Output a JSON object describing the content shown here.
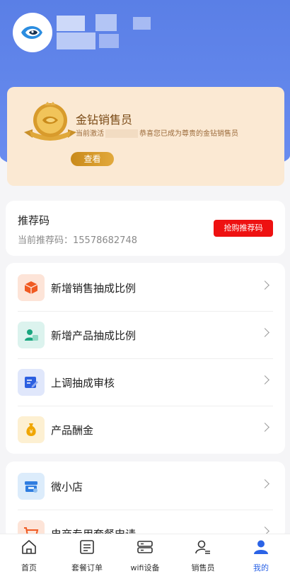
{
  "header": {
    "avatar_icon": "fish-logo-icon"
  },
  "member": {
    "title": "金钻销售员",
    "desc_prefix": "当前激活",
    "desc_suffix": "恭喜您已成为尊贵的金钻销售员",
    "view_button": "查看"
  },
  "referral": {
    "title": "推荐码",
    "label": "当前推荐码：",
    "code": "15578682748",
    "buy_button": "抢购推荐码"
  },
  "menu": [
    {
      "label": "新增销售抽成比例",
      "icon": "cube-icon",
      "bg": "#fde4d8",
      "color": "#f05a22"
    },
    {
      "label": "新增产品抽成比例",
      "icon": "user-card-icon",
      "bg": "#dcf3ee",
      "color": "#1aa67f"
    },
    {
      "label": "上调抽成审核",
      "icon": "edit-document-icon",
      "bg": "#e0e7fb",
      "color": "#2c5fe0"
    },
    {
      "label": "产品酬金",
      "icon": "money-bag-icon",
      "bg": "#fdf0d2",
      "color": "#f0a600"
    }
  ],
  "menu2": [
    {
      "label": "微小店",
      "icon": "shop-icon",
      "bg": "#dcecfb",
      "color": "#2f7de0"
    },
    {
      "label": "电商专用套餐申请",
      "icon": "cart-icon",
      "bg": "#fde4d8",
      "color": "#f05a22"
    }
  ],
  "tabs": [
    {
      "label": "首页",
      "icon": "home-icon"
    },
    {
      "label": "套餐订单",
      "icon": "order-list-icon"
    },
    {
      "label": "wifi设备",
      "icon": "router-icon"
    },
    {
      "label": "销售员",
      "icon": "salesperson-icon"
    },
    {
      "label": "我的",
      "icon": "profile-icon",
      "active": true
    }
  ],
  "colors": {
    "primary": "#5a7fe6",
    "accent_red": "#ee1111",
    "active_tab": "#2b63e6",
    "gold": "#d39a2a"
  }
}
